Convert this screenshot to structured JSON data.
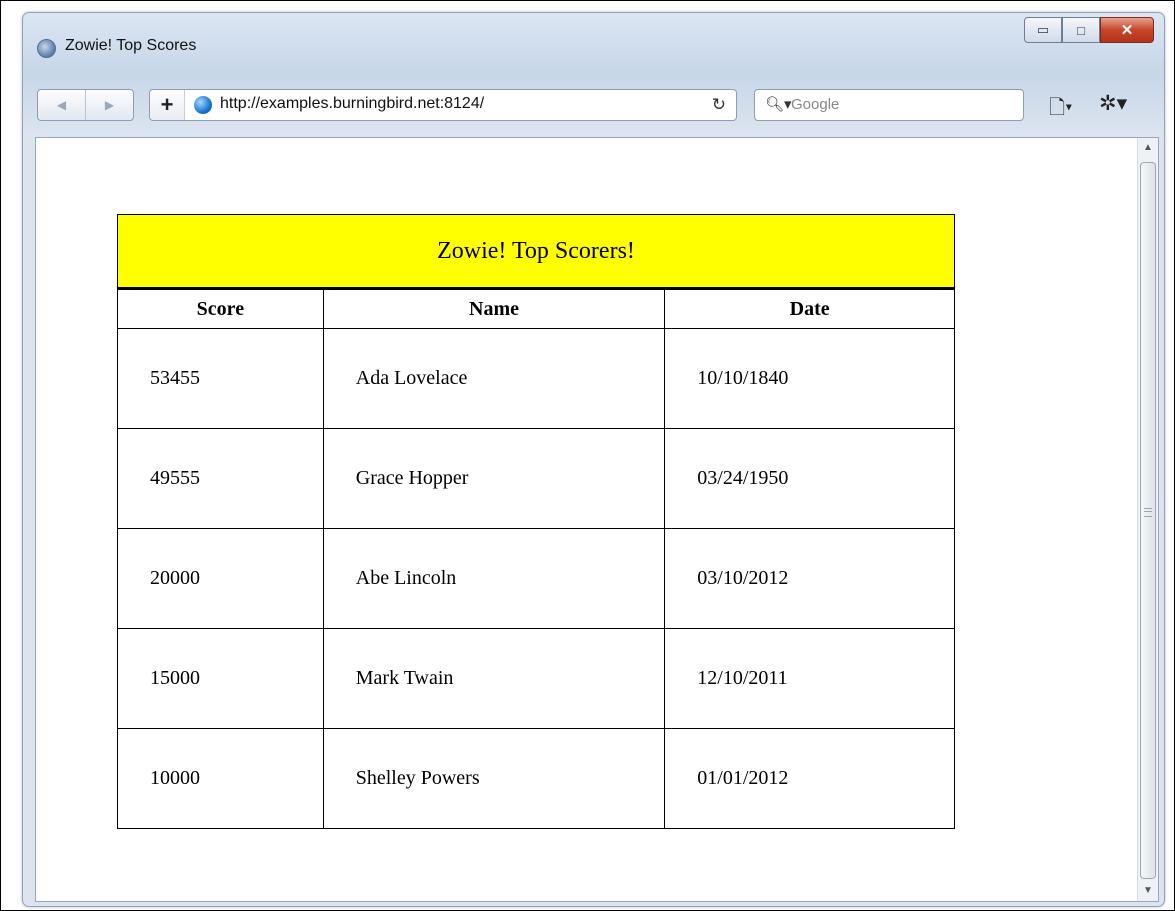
{
  "window": {
    "title": "Zowie! Top Scores",
    "controls": {
      "minimize": "▭",
      "maximize": "□",
      "close": "✕"
    }
  },
  "toolbar": {
    "back_icon": "◀",
    "forward_icon": "▶",
    "add_icon": "+",
    "url": "http://examples.burningbird.net:8124/",
    "reload_icon": "↻",
    "search_icon": "🔍︎▾",
    "search_placeholder": "Google",
    "page_menu_icon": "🗋▾",
    "settings_icon": "✲▾"
  },
  "scrollbar": {
    "up_icon": "▲",
    "down_icon": "▼"
  },
  "table": {
    "caption": "Zowie! Top Scorers!",
    "caption_color": "#ffff00",
    "headers": [
      "Score",
      "Name",
      "Date"
    ],
    "rows": [
      [
        "53455",
        "Ada Lovelace",
        "10/10/1840"
      ],
      [
        "49555",
        "Grace Hopper",
        "03/24/1950"
      ],
      [
        "20000",
        "Abe Lincoln",
        "03/10/2012"
      ],
      [
        "15000",
        "Mark Twain",
        "12/10/2011"
      ],
      [
        "10000",
        "Shelley Powers",
        "01/01/2012"
      ]
    ]
  }
}
